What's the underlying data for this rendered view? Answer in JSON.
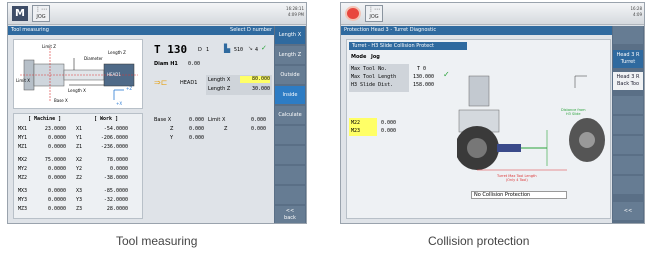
{
  "screens": [
    {
      "top_bar": {
        "mode_letter": "M",
        "jog_label": "JOG",
        "clock": "16:28:11\n4:09 PM"
      },
      "title": "Tool measuring",
      "title_right": "Select D number",
      "diagram": {
        "labels": [
          "Limit Z",
          "Diameter",
          "Limit X",
          "Length X",
          "Base X",
          "Length Z",
          "HEAD1"
        ],
        "values": [
          "+Z",
          "+X"
        ]
      },
      "tool": {
        "label": "T 130",
        "d_label": "D",
        "d_value": "1",
        "st_value": "510",
        "edge_value": "4",
        "diam_label": "Diam H1",
        "diam_value": "0.00",
        "head_label": "HEAD1",
        "length_x_label": "Length X",
        "length_x_value": "80.000",
        "length_z_label": "Length Z",
        "length_z_value": "30.000"
      },
      "base": {
        "base_x_label": "Base X",
        "base_x_value": "0.000",
        "limit_x_label": "Limit X",
        "limit_x_value": "0.000",
        "z_label": "Z",
        "z_value": "0.000",
        "limit_z_label": "Z",
        "limit_z_value": "0.000",
        "y_label": "Y",
        "y_value": "0.000"
      },
      "coords": {
        "machine_header": "[ Machine ]",
        "work_header": "[ Work ]",
        "rows": [
          [
            "MX1",
            "23.0000",
            "X1",
            "-54.0000"
          ],
          [
            "MY1",
            "0.0000",
            "Y1",
            "-206.0000"
          ],
          [
            "MZ1",
            "0.0000",
            "Z1",
            "-236.0000"
          ],
          [
            "MX2",
            "75.0000",
            "X2",
            "78.0000"
          ],
          [
            "MY2",
            "0.0000",
            "Y2",
            "0.0000"
          ],
          [
            "MZ2",
            "0.0000",
            "Z2",
            "-38.0000"
          ],
          [
            "MX3",
            "0.0000",
            "X3",
            "-85.0000"
          ],
          [
            "MY3",
            "0.0000",
            "Y3",
            "-32.0000"
          ],
          [
            "MZ3",
            "0.0000",
            "Z3",
            "28.0000"
          ]
        ]
      },
      "softkeys": [
        "Length X",
        "Length Z",
        "Outside",
        "Inside",
        "Calculate",
        "<<\nback"
      ],
      "caption": "Tool measuring"
    },
    {
      "top_bar": {
        "jog_label": "JOG",
        "clock": "16:28\n4:09"
      },
      "title": "Protection Head 3 - Turret Diagnostic",
      "panel_title": "Turret - H3 Slide Collision Protect",
      "mode_label": "Mode",
      "mode_value": "Jog",
      "params": [
        [
          "Max Tool No.",
          "T 0"
        ],
        [
          "Max Tool Length",
          "130.000"
        ],
        [
          "H3 Slide Dist.",
          "158.000"
        ]
      ],
      "m_values": [
        [
          "M22",
          "0.000"
        ],
        [
          "M23",
          "0.000"
        ]
      ],
      "status": "No Collision Protection",
      "diagram": {
        "distance_label": "Distance from\nH3 Slide",
        "turret_label": "Turret Max Tool Length\n(Only 4 Tool)",
        "axis_x": "+X",
        "axis_z": "+Z"
      },
      "softkeys": [
        "Head 3 R\nTurret",
        "Head 3 R\nBack Too",
        "<<"
      ],
      "caption": "Collision protection"
    }
  ],
  "colors": {
    "accent": "#2f6a9f",
    "softkey": "#667c93",
    "highlight": "#ffff66"
  }
}
